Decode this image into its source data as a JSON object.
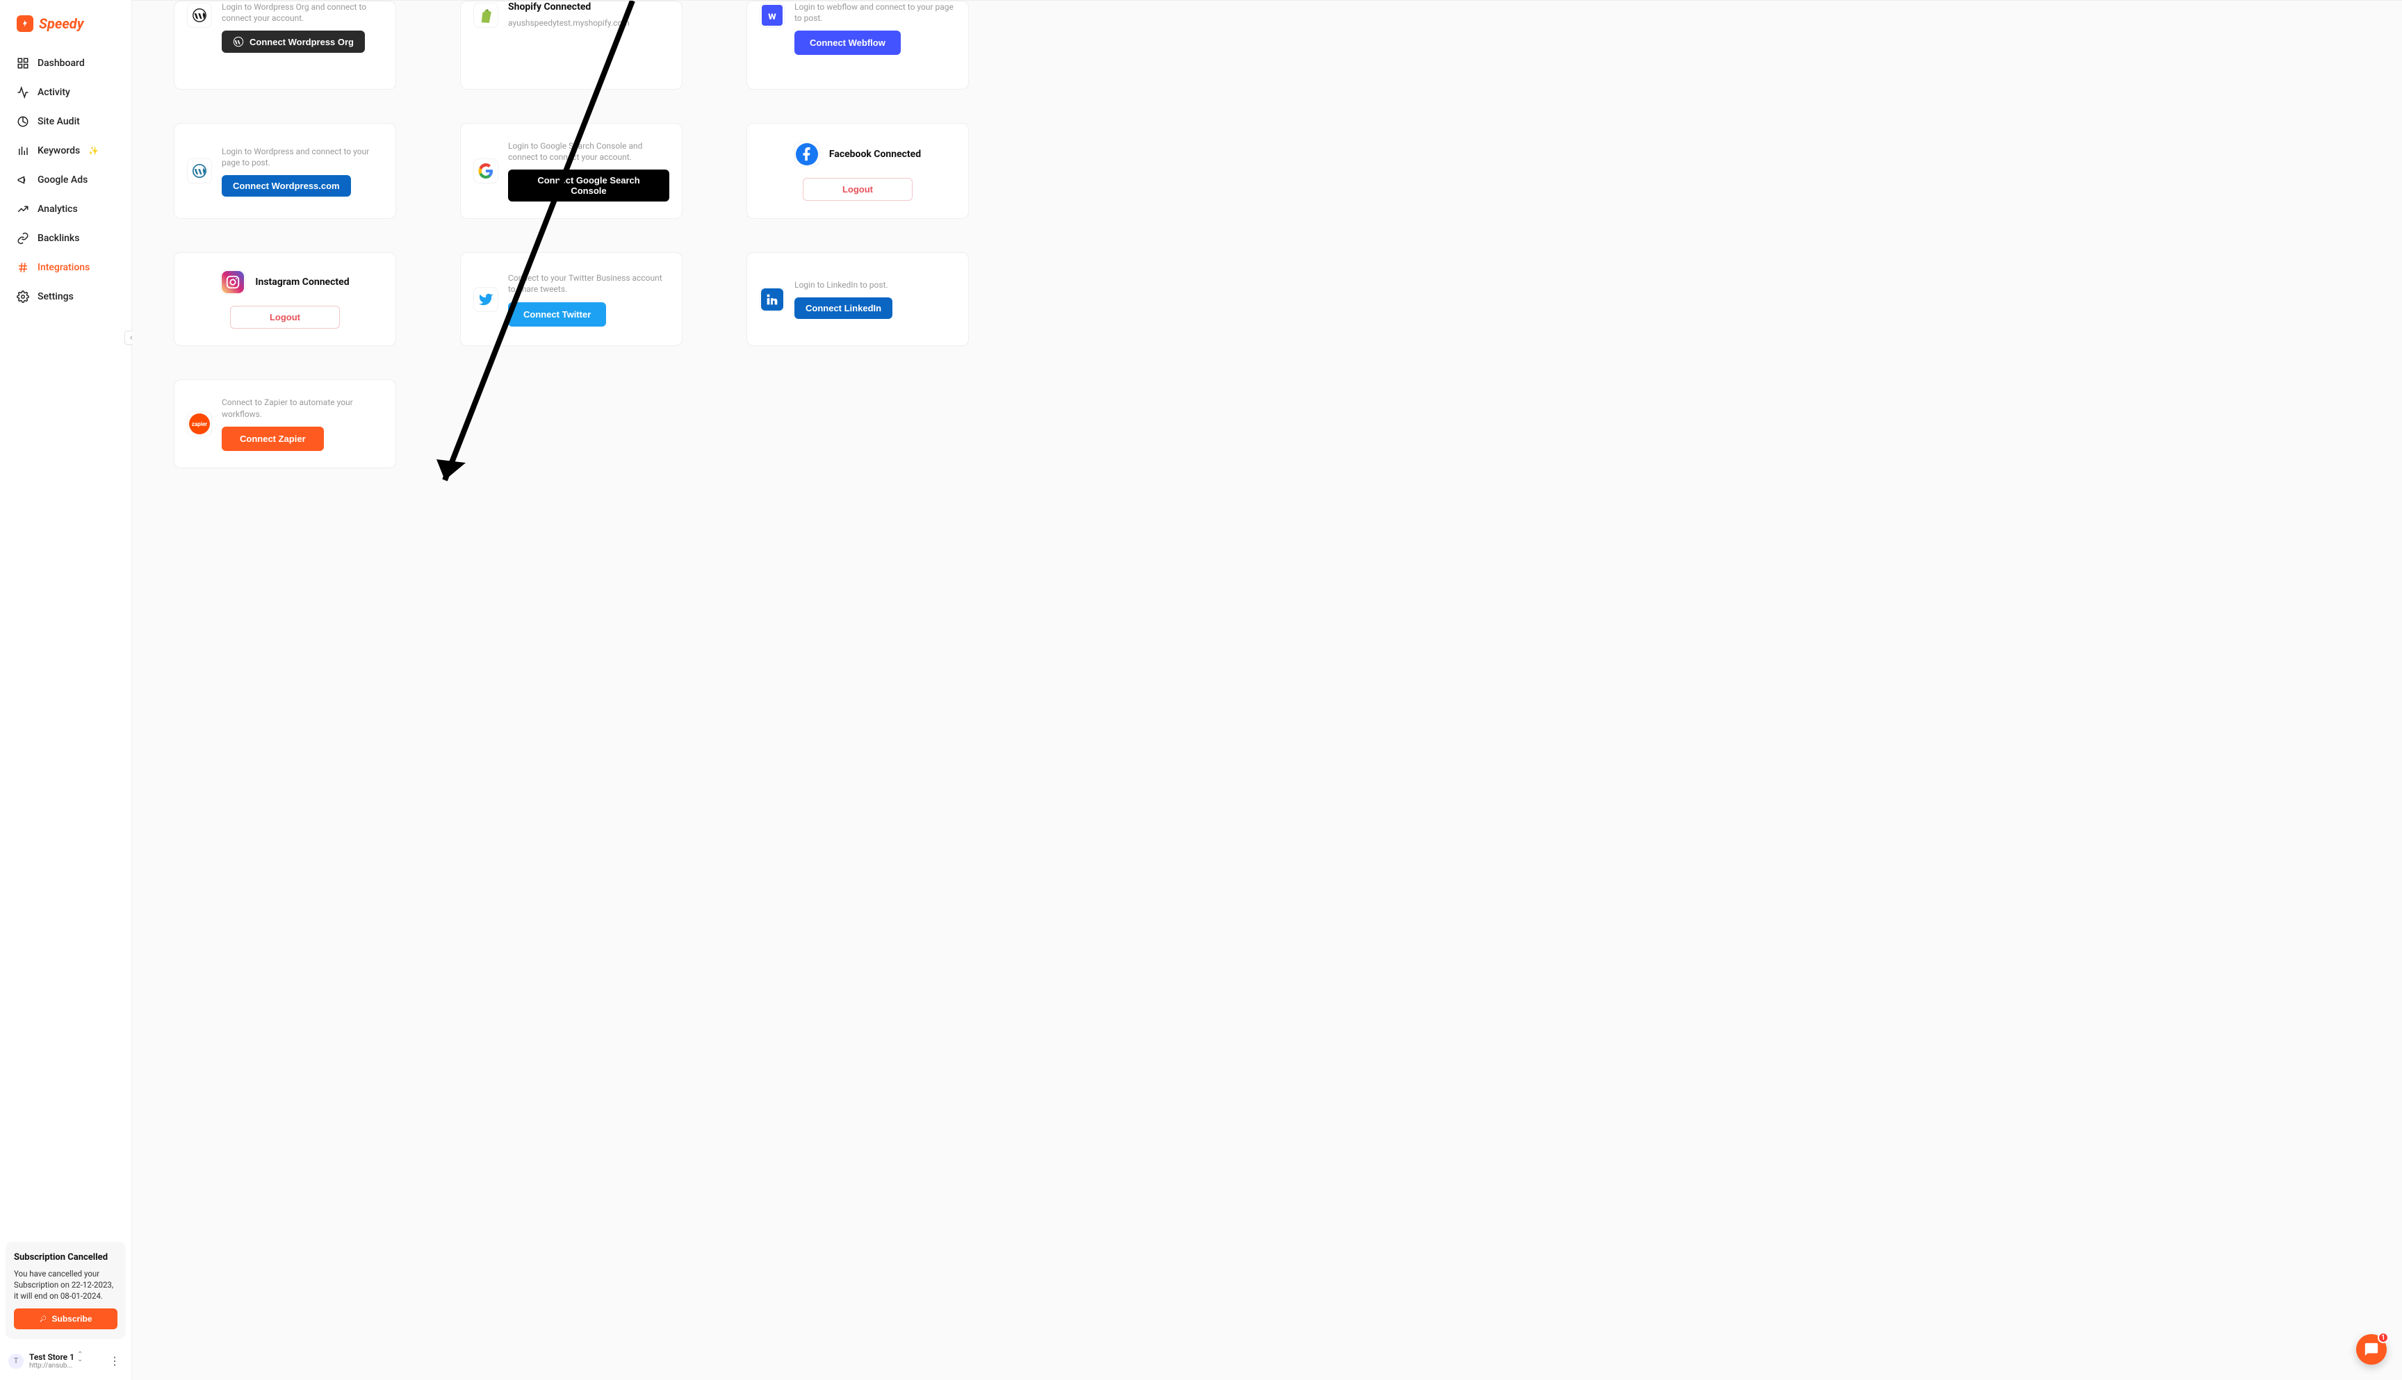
{
  "brand": {
    "name": "Speedy"
  },
  "sidebar": {
    "items": [
      {
        "label": "Dashboard"
      },
      {
        "label": "Activity"
      },
      {
        "label": "Site Audit"
      },
      {
        "label": "Keywords"
      },
      {
        "label": "Google Ads"
      },
      {
        "label": "Analytics"
      },
      {
        "label": "Backlinks"
      },
      {
        "label": "Integrations"
      },
      {
        "label": "Settings"
      }
    ]
  },
  "subscription": {
    "title": "Subscription Cancelled",
    "body": "You have cancelled your Subscription on 22-12-2023, it will end on 08-01-2024.",
    "cta": "Subscribe"
  },
  "store": {
    "avatar_initial": "T",
    "name": "Test Store 1",
    "url": "http://ansub..."
  },
  "cards": {
    "wporg": {
      "desc": "Login to Wordpress Org and connect to connect your account.",
      "button": "Connect Wordpress Org"
    },
    "shopify": {
      "title": "Shopify Connected",
      "sub": "ayushspeedytest.myshopify.com"
    },
    "webflow": {
      "desc": "Login to webflow and connect to your page to post.",
      "button": "Connect Webflow"
    },
    "wpcom": {
      "desc": "Login to Wordpress and connect to your page to post.",
      "button": "Connect Wordpress.com"
    },
    "gsc": {
      "desc": "Login to Google Search Console and connect to connect your account.",
      "button": "Connect Google Search Console"
    },
    "facebook": {
      "title": "Facebook Connected",
      "button": "Logout"
    },
    "instagram": {
      "title": "Instagram Connected",
      "button": "Logout"
    },
    "twitter": {
      "desc": "Connect to your Twitter Business account to share tweets.",
      "button": "Connect Twitter"
    },
    "linkedin": {
      "desc": "Login to LinkedIn to post.",
      "button": "Connect LinkedIn"
    },
    "zapier": {
      "desc": "Connect to Zapier to automate your workflows.",
      "button": "Connect Zapier"
    }
  },
  "chat": {
    "badge": "1"
  }
}
